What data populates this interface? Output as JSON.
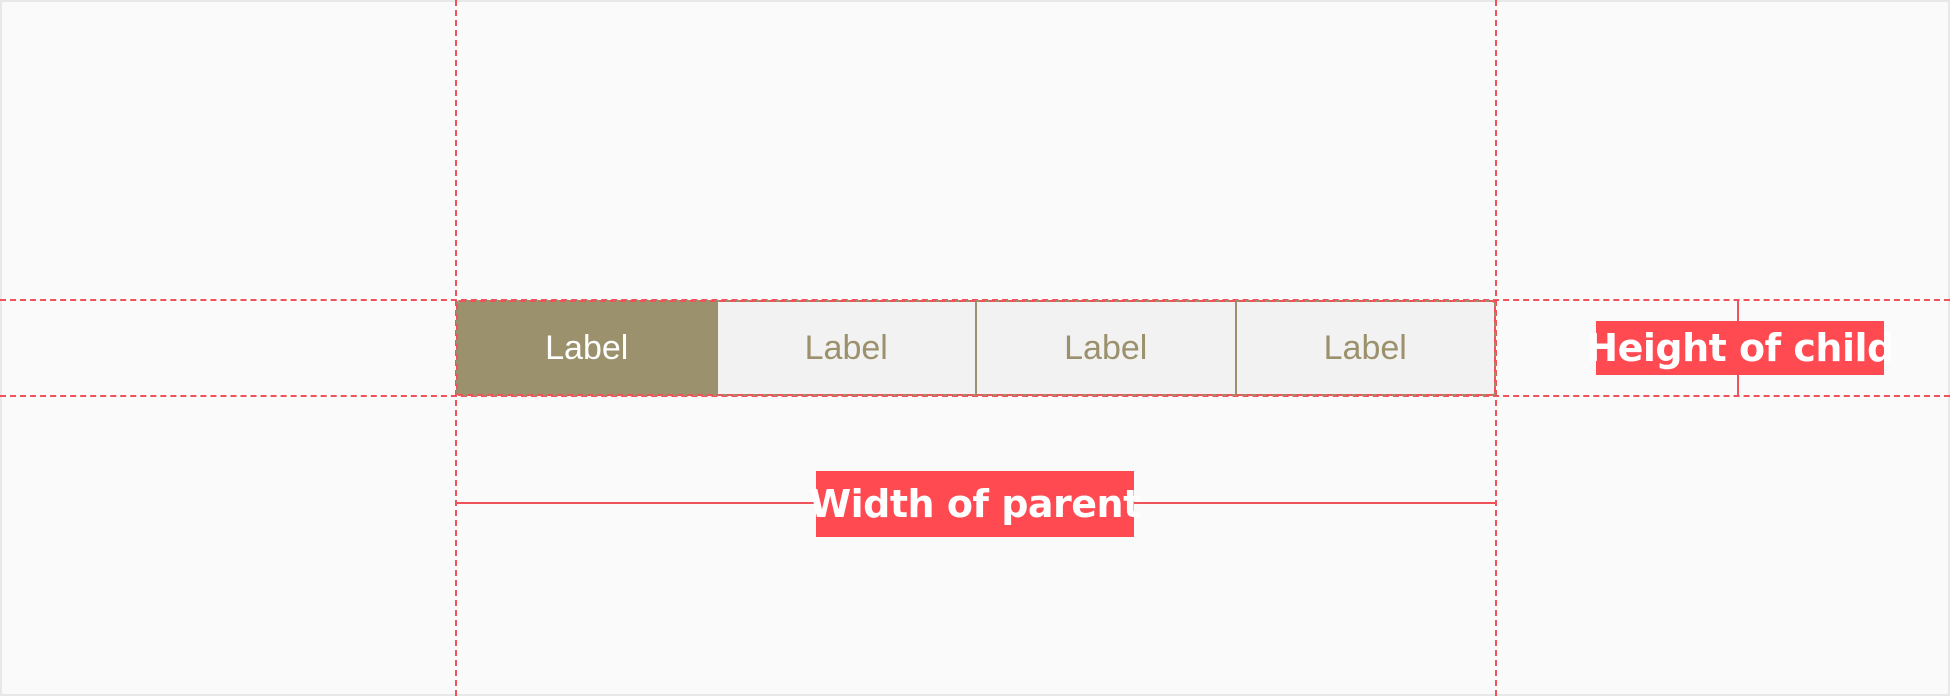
{
  "segmented_control": {
    "segments": [
      {
        "label": "Label",
        "selected": true
      },
      {
        "label": "Label",
        "selected": false
      },
      {
        "label": "Label",
        "selected": false
      },
      {
        "label": "Label",
        "selected": false
      }
    ]
  },
  "annotations": {
    "width_label": "Width of parent",
    "height_label": "Height of child"
  },
  "colors": {
    "accent": "#9b916c",
    "guide": "#f0525a",
    "tag_background": "#ff4a52",
    "segment_background": "#f2f2f2",
    "canvas": "#fafafa"
  }
}
